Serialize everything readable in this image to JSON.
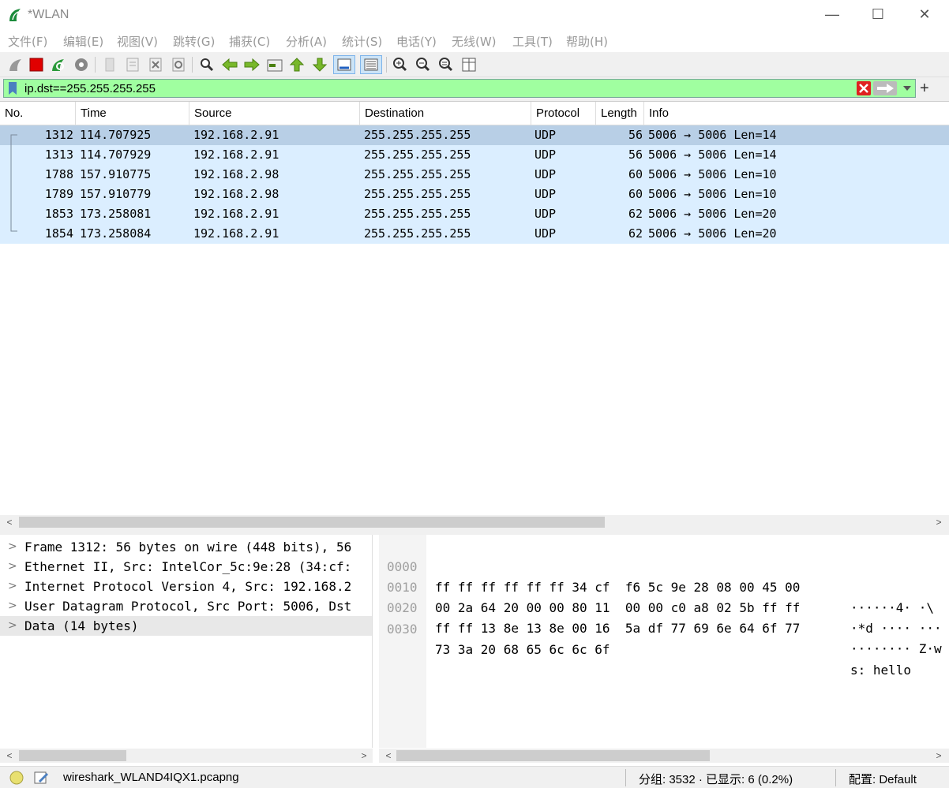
{
  "window": {
    "title": "*WLAN",
    "minimize": "—",
    "maximize": "☐",
    "close": "✕"
  },
  "menu": [
    "文件(F)",
    "编辑(E)",
    "视图(V)",
    "跳转(G)",
    "捕获(C)",
    "分析(A)",
    "统计(S)",
    "电话(Y)",
    "无线(W)",
    "工具(T)",
    "帮助(H)"
  ],
  "toolbar": {
    "icons": [
      "shark-fin-start-icon",
      "stop-capture-icon",
      "restart-capture-icon",
      "capture-options-icon",
      "open-file-icon",
      "save-file-icon",
      "close-file-icon",
      "reload-file-icon",
      "find-packet-icon",
      "go-back-icon",
      "go-forward-icon",
      "go-to-packet-icon",
      "first-packet-icon",
      "last-packet-icon",
      "auto-scroll-icon",
      "colorize-icon",
      "zoom-in-icon",
      "zoom-out-icon",
      "normal-size-icon",
      "resize-columns-icon"
    ]
  },
  "filter": {
    "value": "ip.dst==255.255.255.255",
    "add_label": "+"
  },
  "colors": {
    "filter_bg": "#a0ffa0",
    "row_bg": "#dbeeff",
    "selected_row_bg": "#b8cfe6",
    "clear_button": "#e02020"
  },
  "packet_list": {
    "columns": [
      "No.",
      "Time",
      "Source",
      "Destination",
      "Protocol",
      "Length",
      "Info"
    ],
    "rows": [
      {
        "no": "1312",
        "time": "114.707925",
        "source": "192.168.2.91",
        "destination": "255.255.255.255",
        "protocol": "UDP",
        "length": "56",
        "info": "5006 → 5006 Len=14"
      },
      {
        "no": "1313",
        "time": "114.707929",
        "source": "192.168.2.91",
        "destination": "255.255.255.255",
        "protocol": "UDP",
        "length": "56",
        "info": "5006 → 5006 Len=14"
      },
      {
        "no": "1788",
        "time": "157.910775",
        "source": "192.168.2.98",
        "destination": "255.255.255.255",
        "protocol": "UDP",
        "length": "60",
        "info": "5006 → 5006 Len=10"
      },
      {
        "no": "1789",
        "time": "157.910779",
        "source": "192.168.2.98",
        "destination": "255.255.255.255",
        "protocol": "UDP",
        "length": "60",
        "info": "5006 → 5006 Len=10"
      },
      {
        "no": "1853",
        "time": "173.258081",
        "source": "192.168.2.91",
        "destination": "255.255.255.255",
        "protocol": "UDP",
        "length": "62",
        "info": "5006 → 5006 Len=20"
      },
      {
        "no": "1854",
        "time": "173.258084",
        "source": "192.168.2.91",
        "destination": "255.255.255.255",
        "protocol": "UDP",
        "length": "62",
        "info": "5006 → 5006 Len=20"
      }
    ]
  },
  "details": [
    "Frame 1312: 56 bytes on wire (448 bits), 56",
    "Ethernet II, Src: IntelCor_5c:9e:28 (34:cf:",
    "Internet Protocol Version 4, Src: 192.168.2",
    "User Datagram Protocol, Src Port: 5006, Dst",
    "Data (14 bytes)"
  ],
  "bytes": [
    {
      "offset": "0000",
      "hex": "ff ff ff ff ff ff 34 cf  f6 5c 9e 28 08 00 45 00",
      "ascii": "······4· ·\\"
    },
    {
      "offset": "0010",
      "hex": "00 2a 64 20 00 00 80 11  00 00 c0 a8 02 5b ff ff",
      "ascii": "·*d ···· ···"
    },
    {
      "offset": "0020",
      "hex": "ff ff 13 8e 13 8e 00 16  5a df 77 69 6e 64 6f 77",
      "ascii": "········ Z·w"
    },
    {
      "offset": "0030",
      "hex": "73 3a 20 68 65 6c 6c 6f",
      "ascii": "s: hello"
    }
  ],
  "status": {
    "file": "wireshark_WLAND4IQX1.pcapng",
    "packets": "分组: 3532 · 已显示: 6 (0.2%)",
    "profile": "配置: Default"
  }
}
